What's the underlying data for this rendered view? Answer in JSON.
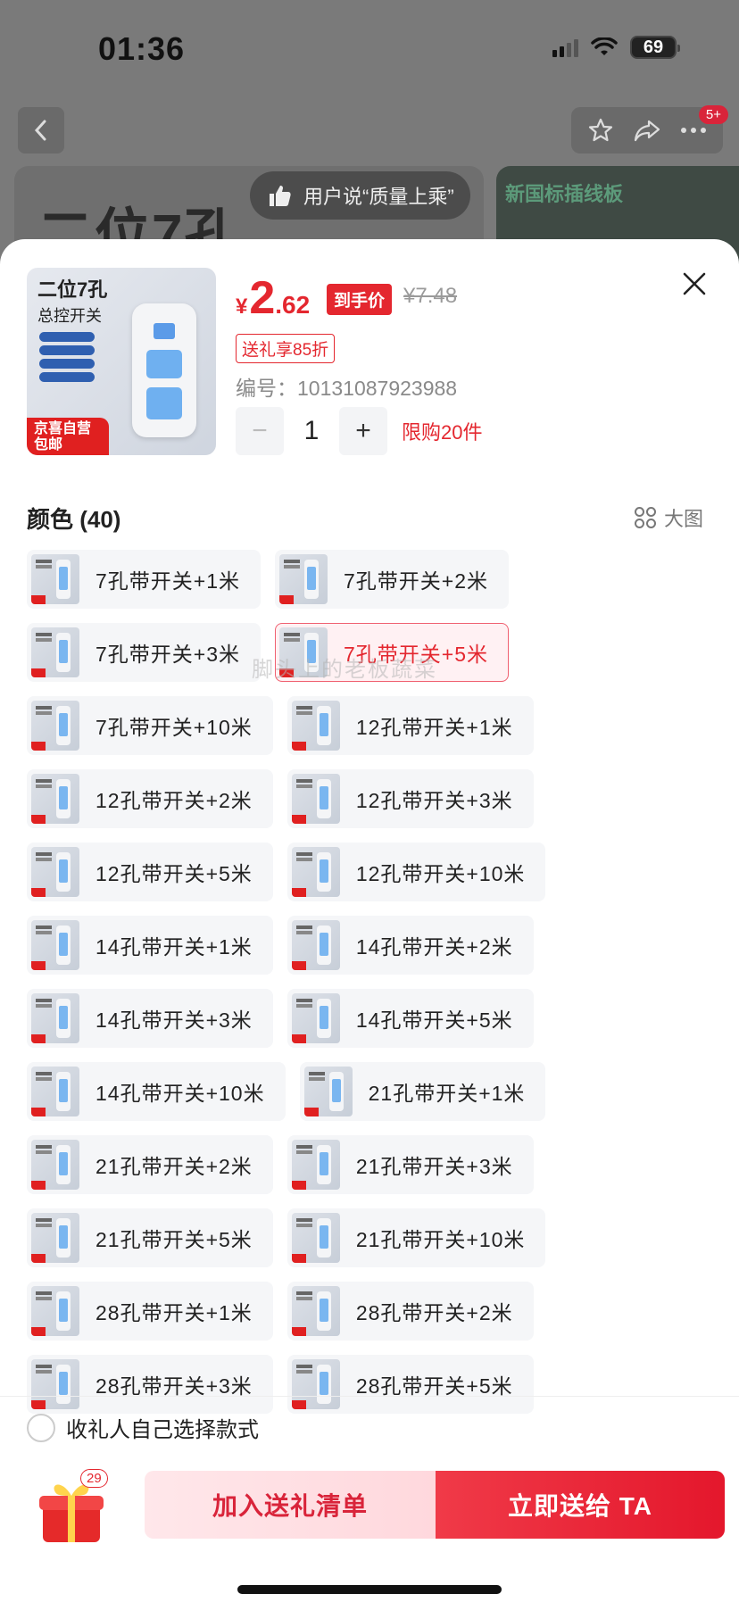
{
  "status_bar": {
    "time": "01:36",
    "battery": "69"
  },
  "header": {
    "cart_count": "5+"
  },
  "hero": {
    "left_text": "二位7孔",
    "review_text": "用户说“质量上乘”",
    "right_text": "新国标插线板"
  },
  "product": {
    "thumb_title": "二位7孔",
    "thumb_subtitle": "总控开关",
    "thumb_tag": "京喜自营包邮",
    "price_currency": "¥",
    "price_int": "2",
    "price_dec": ".62",
    "price_label": "到手价",
    "original_price": "¥7.48",
    "discount": "送礼享85折",
    "sku": "编号：10131087923988",
    "quantity": "1",
    "limit": "限购20件"
  },
  "colors": {
    "heading": "颜色 (40)",
    "big_view": "大图",
    "rows": [
      [
        {
          "label": "7孔带开关+1米"
        },
        {
          "label": "7孔带开关+2米"
        }
      ],
      [
        {
          "label": "7孔带开关+3米"
        },
        {
          "label": "7孔带开关+5米",
          "selected": true
        }
      ],
      [
        {
          "label": "7孔带开关+10米"
        },
        {
          "label": "12孔带开关+1米"
        }
      ],
      [
        {
          "label": "12孔带开关+2米"
        },
        {
          "label": "12孔带开关+3米"
        }
      ],
      [
        {
          "label": "12孔带开关+5米"
        },
        {
          "label": "12孔带开关+10米"
        }
      ],
      [
        {
          "label": "14孔带开关+1米"
        },
        {
          "label": "14孔带开关+2米"
        }
      ],
      [
        {
          "label": "14孔带开关+3米"
        },
        {
          "label": "14孔带开关+5米"
        }
      ],
      [
        {
          "label": "14孔带开关+10米"
        },
        {
          "label": "21孔带开关+1米"
        }
      ],
      [
        {
          "label": "21孔带开关+2米"
        },
        {
          "label": "21孔带开关+3米"
        }
      ],
      [
        {
          "label": "21孔带开关+5米"
        },
        {
          "label": "21孔带开关+10米"
        }
      ],
      [
        {
          "label": "28孔带开关+1米"
        },
        {
          "label": "28孔带开关+2米"
        }
      ],
      [
        {
          "label": "28孔带开关+3米"
        },
        {
          "label": "28孔带开关+5米"
        }
      ]
    ]
  },
  "watermark": "脚头上的老板蔬菜",
  "footer": {
    "self_choose": "收礼人自己选择款式",
    "gift_badge": "29",
    "add_button": "加入送礼清单",
    "send_button": "立即送给 TA"
  },
  "colors_theme": {
    "accent": "#e4272f",
    "selected_bg": "#fff1f3"
  }
}
